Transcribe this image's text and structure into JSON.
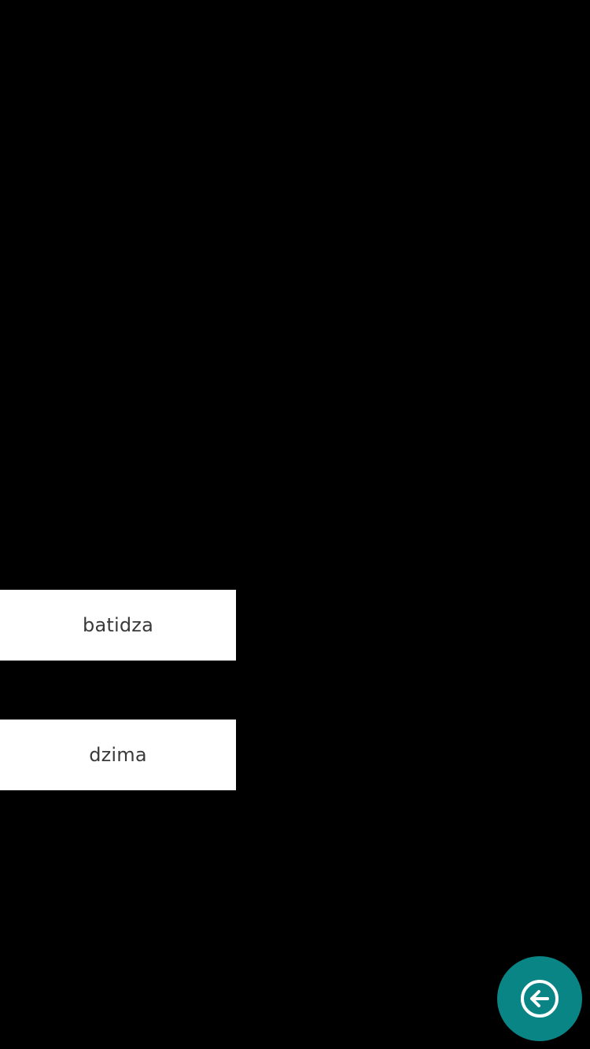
{
  "options": {
    "items": [
      {
        "label": "batidza"
      },
      {
        "label": "dzima"
      }
    ]
  },
  "fab": {
    "icon": "back-arrow-circle-icon",
    "color": "#0a8585"
  }
}
